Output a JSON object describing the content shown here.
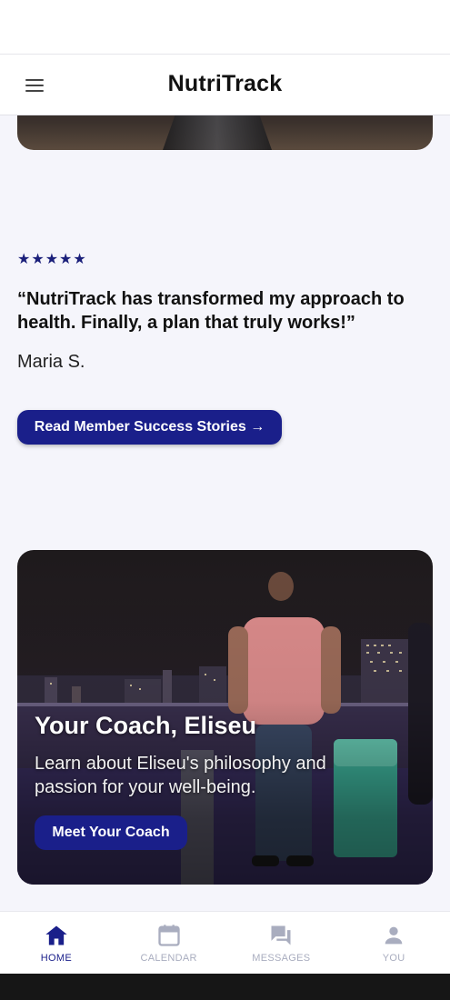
{
  "app": {
    "title": "NutriTrack"
  },
  "testimonial": {
    "stars": "★★★★★",
    "rating": 5,
    "quote": "“NutriTrack has transformed my approach to health. Finally, a plan that truly works!”",
    "author": "Maria S.",
    "cta_label": "Read Member Success Stories →"
  },
  "coach": {
    "title": "Your Coach, Eliseu",
    "description": "Learn about Eliseu's philosophy and passion for your well-being.",
    "cta_label": "Meet Your Coach"
  },
  "bottom_nav": {
    "items": [
      {
        "label": "HOME",
        "icon": "home-icon",
        "active": true
      },
      {
        "label": "CALENDAR",
        "icon": "calendar-icon",
        "active": false
      },
      {
        "label": "MESSAGES",
        "icon": "messages-icon",
        "active": false
      },
      {
        "label": "YOU",
        "icon": "person-icon",
        "active": false
      }
    ]
  },
  "colors": {
    "accent": "#1a1f8a",
    "nav_inactive": "#a9adbf",
    "background": "#f5f5fb"
  }
}
